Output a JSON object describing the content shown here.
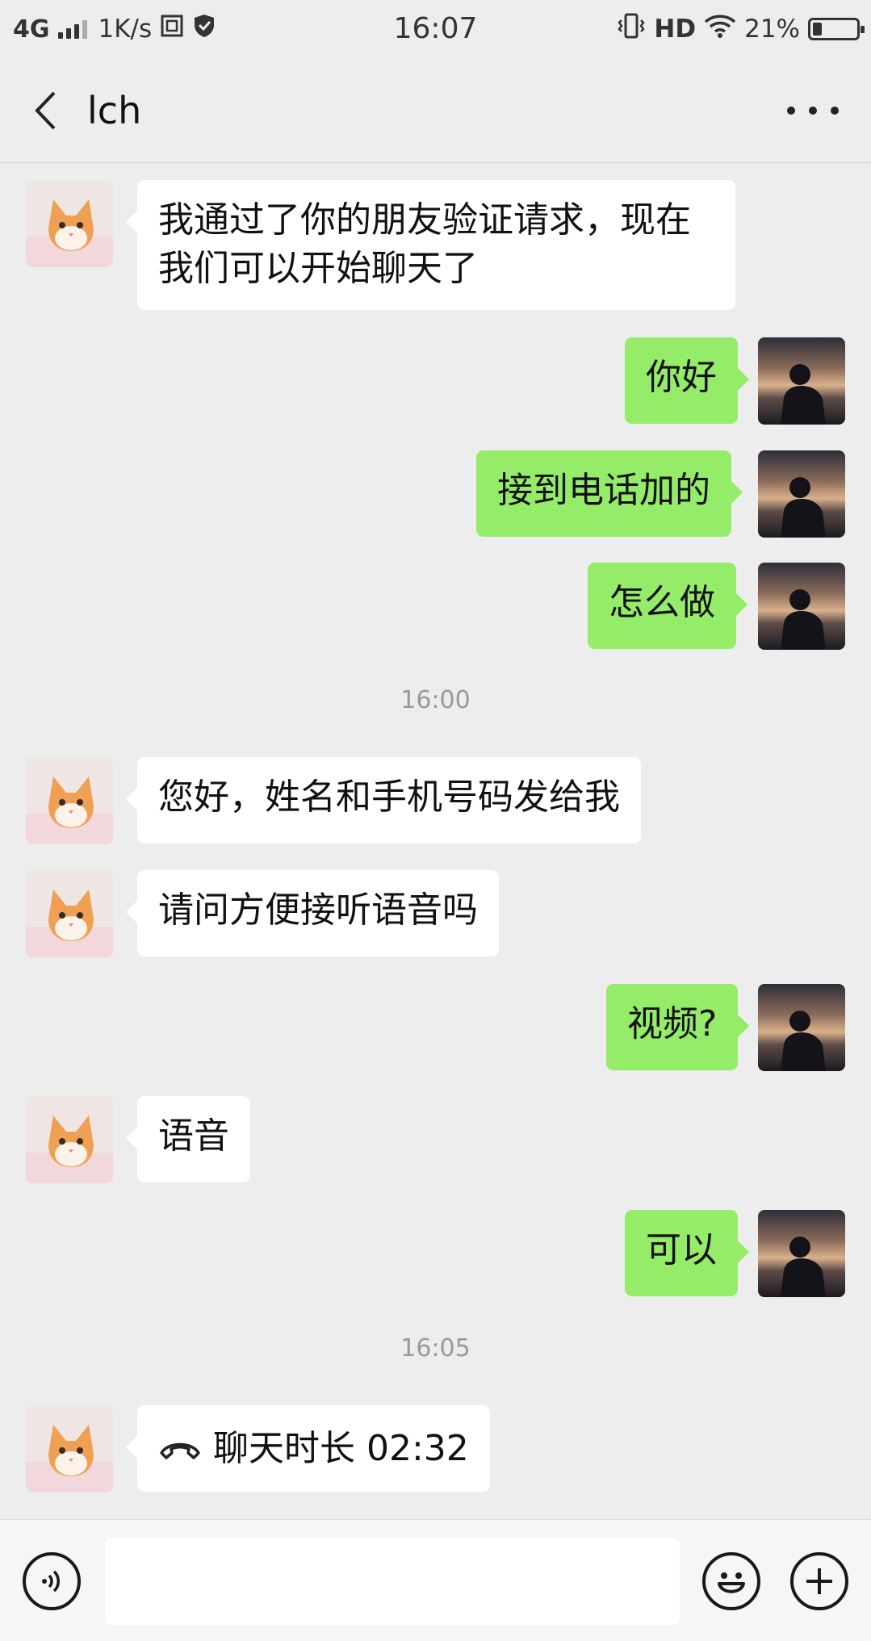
{
  "status_bar": {
    "network": "4G",
    "speed": "1K/s",
    "time": "16:07",
    "hd": "HD",
    "battery": "21%",
    "battery_level": 0.21
  },
  "header": {
    "back_icon": "chevron-left-icon",
    "title": "lch",
    "more_icon": "more-dots-icon"
  },
  "messages": [
    {
      "side": "left",
      "text_line1": "我通过了你的朋友验证请求，现在",
      "text_line2": "我们可以开始聊天了"
    },
    {
      "side": "right",
      "text": "你好"
    },
    {
      "side": "right",
      "text": "接到电话加的"
    },
    {
      "side": "right",
      "text": "怎么做"
    },
    {
      "type": "time",
      "text": "16:00"
    },
    {
      "side": "left",
      "text": "您好，姓名和手机号码发给我"
    },
    {
      "side": "left",
      "text": "请问方便接听语音吗"
    },
    {
      "side": "right",
      "text": "视频?"
    },
    {
      "side": "left",
      "text": "语音"
    },
    {
      "side": "right",
      "text": "可以"
    },
    {
      "type": "time",
      "text": "16:05"
    },
    {
      "side": "left",
      "icon": "phone-hangup-icon",
      "text": "聊天时长 02:32"
    }
  ],
  "input_bar": {
    "voice_icon": "voice-icon",
    "placeholder": "",
    "emoji_icon": "emoji-icon",
    "plus_icon": "plus-icon"
  },
  "colors": {
    "background": "#ededed",
    "sent_bubble": "#95ec69",
    "received_bubble": "#ffffff"
  }
}
